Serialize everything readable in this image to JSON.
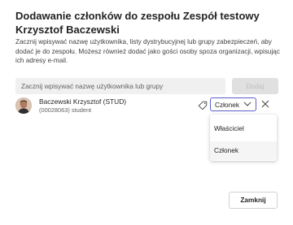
{
  "dialog": {
    "title": "Dodawanie członków do zespołu Zespół testowy Krzysztof Baczewski",
    "description": "Zacznij wpisywać nazwę użytkownika, listy dystrybucyjnej lub grupy zabezpieczeń, aby dodać je do zespołu. Możesz również dodać jako gości osoby spoza organizacji, wpisując ich adresy e-mail."
  },
  "search": {
    "placeholder": "Zacznij wpisywać nazwę użytkownika lub grupy",
    "add_label": "Dodaj"
  },
  "selected_user": {
    "name": "Baczewski Krzysztof (STUD)",
    "subtitle": "(00028063) student",
    "role": "Członek"
  },
  "role_menu": {
    "options": [
      "Właściciel",
      "Członek"
    ],
    "selected": "Członek"
  },
  "footer": {
    "close_label": "Zamknij"
  },
  "colors": {
    "accent": "#5b5fc7",
    "disabled_button_bg": "#e0e0e0",
    "input_bg": "#f0f0f0"
  },
  "icons": {
    "tag": "tag-icon",
    "chevron": "chevron-down-icon",
    "remove": "close-icon"
  }
}
